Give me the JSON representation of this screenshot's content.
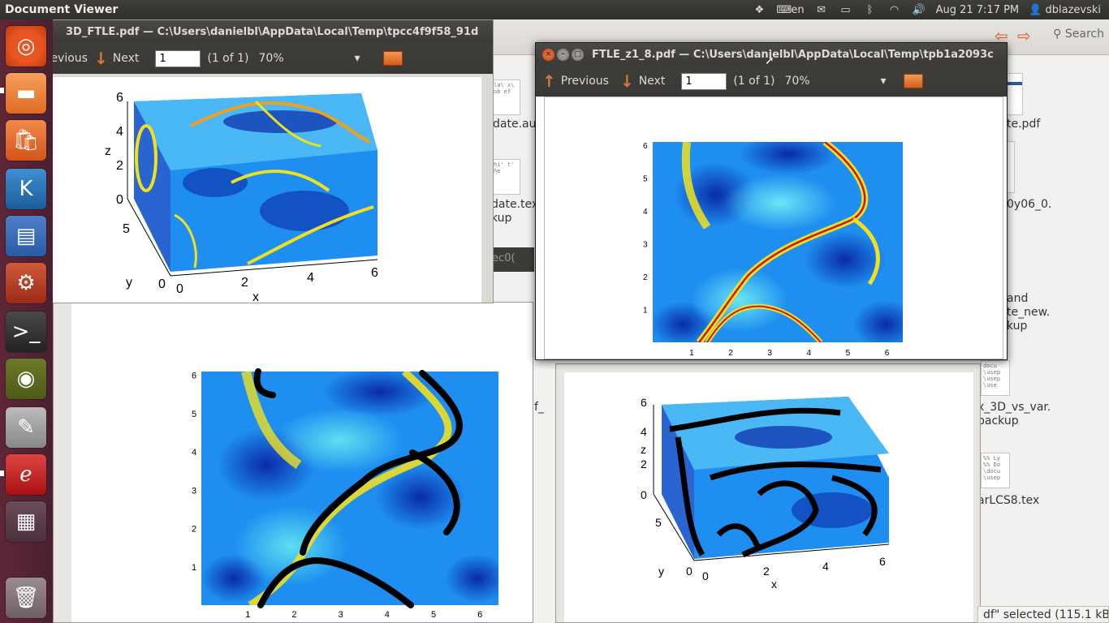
{
  "topbar": {
    "app_name": "Document Viewer",
    "keyboard": "en",
    "date_time": "Aug 21  7:17 PM",
    "user": "dblazevski"
  },
  "launcher": {
    "items": [
      "dash-icon",
      "files-icon",
      "software-center-icon",
      "kile-icon",
      "writer-icon",
      "settings-icon",
      "terminal-icon",
      "chrome-icon",
      "text-editor-icon",
      "document-viewer-icon",
      "workspace-switcher-icon",
      "trash-icon"
    ]
  },
  "nautilus": {
    "search_label": "Search",
    "files": [
      {
        "name": "date.aux"
      },
      {
        "name": "date.tex\nkup"
      },
      {
        "name": "te.pdf"
      },
      {
        "name": "0y06_0."
      },
      {
        "name": "and\nte_new.\nkup"
      },
      {
        "name": "f_"
      },
      {
        "name": "x_3D_vs_var.\nbackup"
      },
      {
        "name": "arLCS8.tex"
      }
    ],
    "partial_title": "ec0("
  },
  "status_bar": {
    "text": "df\" selected (115.1 kB)"
  },
  "window_3d": {
    "title": "3D_FTLE.pdf — C:\\Users\\danielbl\\AppData\\Local\\Temp\\tpcc4f9f58_91d",
    "previous": "revious",
    "next": "Next",
    "page_value": "1",
    "page_of": "(1 of 1)",
    "zoom": "70%"
  },
  "window_z1": {
    "title": "FTLE_z1_8.pdf — C:\\Users\\danielbl\\AppData\\Local\\Temp\\tpb1a2093c",
    "previous": "Previous",
    "next": "Next",
    "page_value": "1",
    "page_of": "(1 of 1)",
    "zoom": "70%"
  },
  "figure_2d": {
    "x_ticks": [
      "1",
      "2",
      "3",
      "4",
      "5",
      "6"
    ],
    "y_ticks": [
      "1",
      "2",
      "3",
      "4",
      "5",
      "6"
    ]
  },
  "figure_3d": {
    "z_label": "z",
    "y_label": "y",
    "x_label": "x",
    "z_ticks": [
      "6",
      "4",
      "2",
      "0"
    ],
    "y_ticks": [
      "5",
      "0"
    ],
    "x_ticks": [
      "0",
      "2",
      "4",
      "6"
    ]
  },
  "colors": {
    "ftle_low": "#0a2aa8",
    "ftle_mid": "#22c4f0",
    "ftle_high": "#f0e020",
    "ftle_peak": "#c81a0a",
    "panel_dark": "#3c3b37",
    "accent_orange": "#e95420"
  }
}
